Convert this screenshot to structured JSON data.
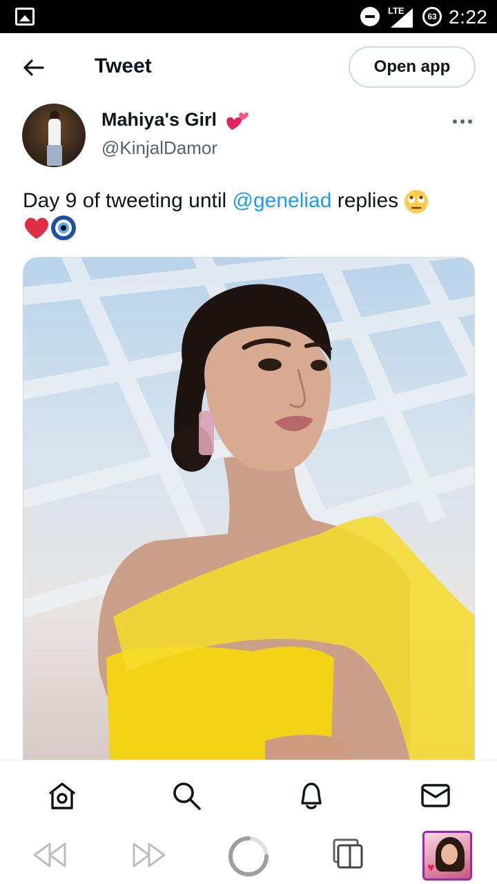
{
  "status_bar": {
    "network": "LTE",
    "battery": "63",
    "time": "2:22"
  },
  "header": {
    "title": "Tweet",
    "open_app_label": "Open app"
  },
  "author": {
    "name": "Mahiya's Girl",
    "handle": "@KinjalDamor",
    "name_emoji_icon": "two-hearts-icon"
  },
  "tweet": {
    "text_before": "Day 9 of tweeting until ",
    "mention": "@geneliad",
    "text_after": " replies ",
    "emojis": [
      "face-with-rolling-eyes-icon",
      "red-heart-icon",
      "nazar-amulet-icon"
    ],
    "mention_color": "#1d9bf0"
  },
  "bottom_nav": {
    "items": [
      "home-icon",
      "search-icon",
      "notifications-icon",
      "messages-icon"
    ]
  },
  "browser_toolbar": {
    "items": [
      "rewind-icon",
      "fast-forward-icon",
      "loading-spinner-icon",
      "tabs-icon",
      "tab-thumbnail"
    ],
    "accent": "#9c27b0"
  }
}
